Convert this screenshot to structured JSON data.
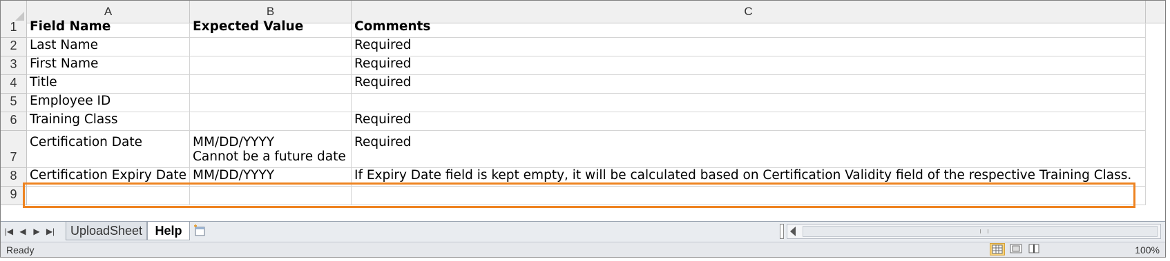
{
  "columns": [
    "A",
    "B",
    "C"
  ],
  "rows": [
    {
      "num": "1",
      "a": "Field Name",
      "b": "Expected Value",
      "c": "Comments",
      "bold": true
    },
    {
      "num": "2",
      "a": "Last Name",
      "b": "",
      "c": "Required"
    },
    {
      "num": "3",
      "a": "First Name",
      "b": "",
      "c": "Required"
    },
    {
      "num": "4",
      "a": "Title",
      "b": "",
      "c": "Required"
    },
    {
      "num": "5",
      "a": "Employee ID",
      "b": "",
      "c": ""
    },
    {
      "num": "6",
      "a": "Training Class",
      "b": "",
      "c": "Required"
    },
    {
      "num": "7",
      "a": "Certification Date",
      "b": "MM/DD/YYYY",
      "b2": "Cannot be a future date",
      "c": "Required"
    },
    {
      "num": "8",
      "a": "Certification Expiry Date",
      "b": "MM/DD/YYYY",
      "c": "If Expiry Date field is kept empty, it will be calculated based on Certification Validity field of the respective Training Class."
    },
    {
      "num": "9",
      "a": "",
      "b": "",
      "c": ""
    }
  ],
  "sheet_tabs": [
    "UploadSheet",
    "Help"
  ],
  "active_tab": "Help",
  "status": {
    "ready": "Ready",
    "zoom": "100%"
  },
  "colors": {
    "highlight": "#ee8320",
    "header_bg": "#f0f0f0"
  },
  "icons": [
    "first-sheet-icon",
    "prev-sheet-icon",
    "next-sheet-icon",
    "last-sheet-icon",
    "insert-sheet-icon",
    "normal-view-icon",
    "page-layout-icon",
    "page-break-icon"
  ]
}
